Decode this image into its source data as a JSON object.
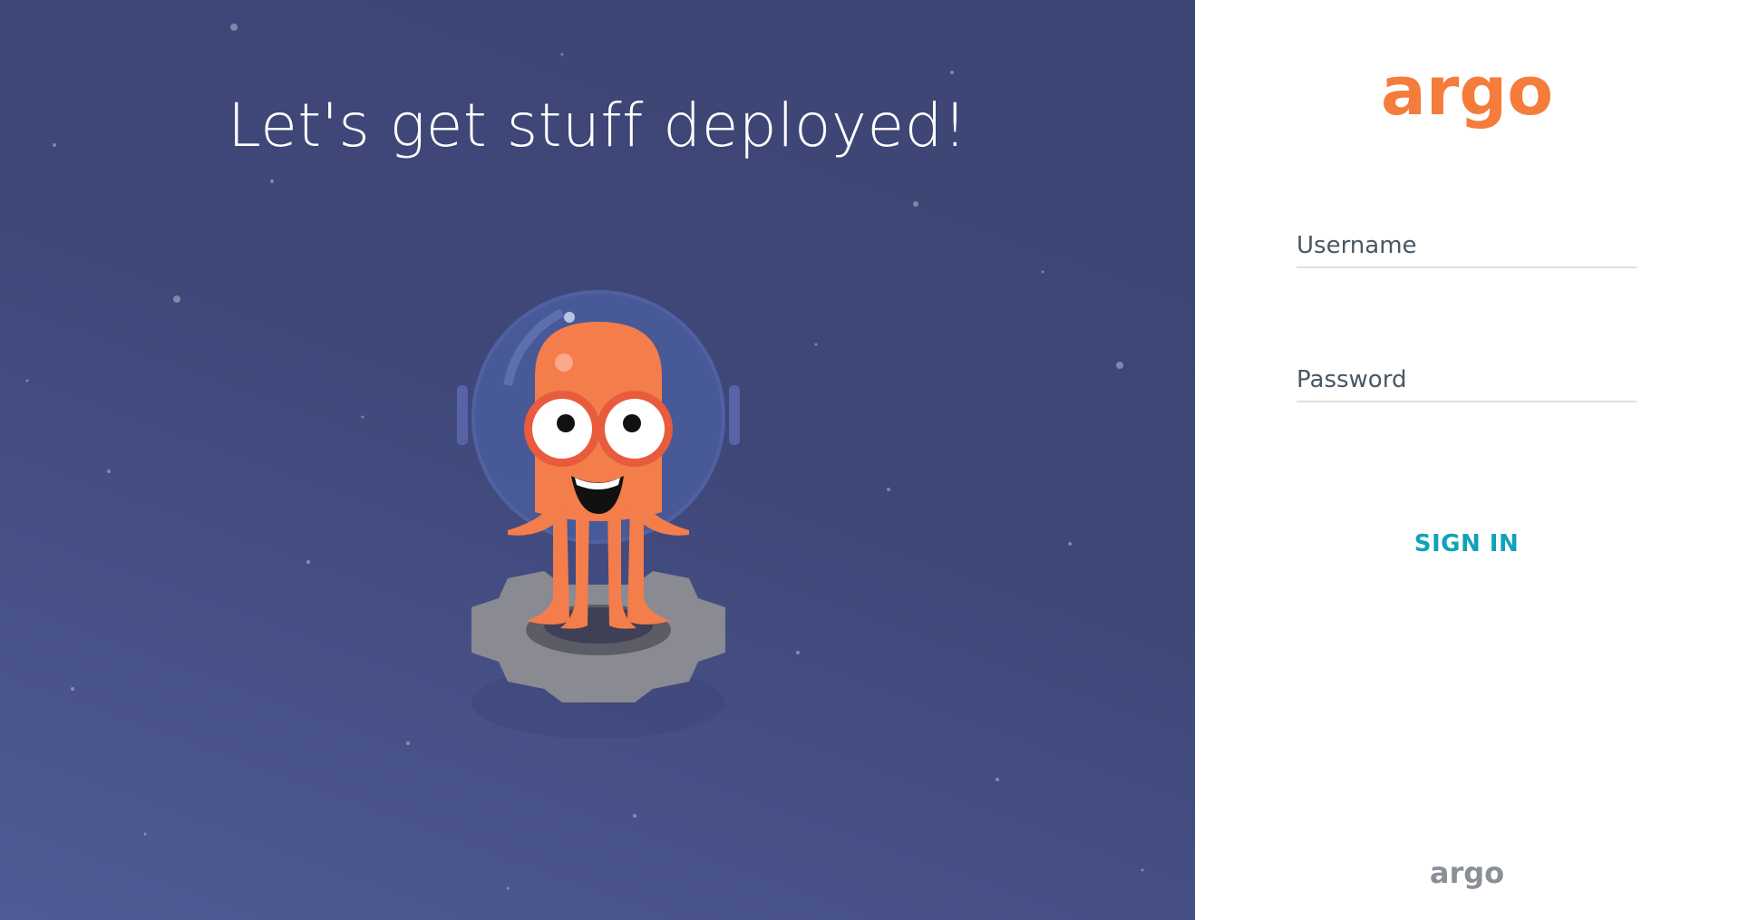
{
  "hero": {
    "title": "Let's get stuff deployed!"
  },
  "login": {
    "logo_text": "argo",
    "username_placeholder": "Username",
    "password_placeholder": "Password",
    "signin_label": "SIGN IN",
    "footer_logo_text": "argo"
  },
  "colors": {
    "brand_orange": "#f57c3b",
    "signin_teal": "#11a2b8",
    "hero_bg": "#3f4778"
  },
  "icons": {
    "mascot": "argo-octopus-mascot-icon",
    "logo": "argo-logo-icon"
  }
}
